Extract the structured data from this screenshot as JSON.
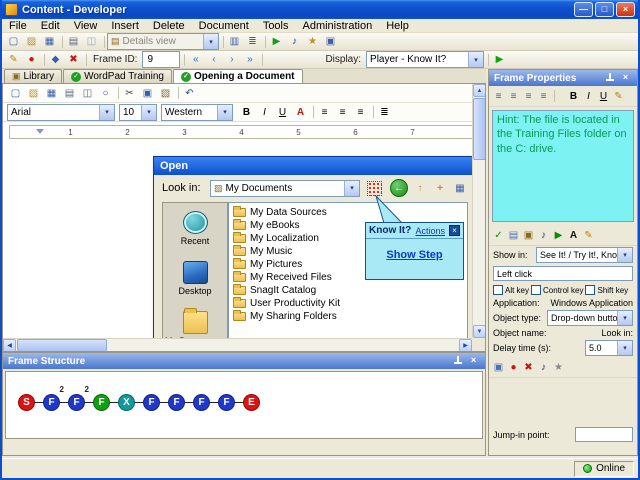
{
  "glyphs": {
    "dropdown_arrow": "▾",
    "up_arrow": "▲",
    "down_arrow": "▼",
    "left_arrow": "◀",
    "right_arrow": "▶",
    "close": "×"
  },
  "titlebar": {
    "title": "Content - Developer",
    "buttons": {
      "minimize": "—",
      "maximize": "□",
      "close": "×"
    }
  },
  "menubar": {
    "items": [
      {
        "n": "menu-file",
        "label": "File"
      },
      {
        "n": "menu-edit",
        "label": "Edit"
      },
      {
        "n": "menu-view",
        "label": "View"
      },
      {
        "n": "menu-insert",
        "label": "Insert"
      },
      {
        "n": "menu-delete",
        "label": "Delete"
      },
      {
        "n": "menu-document",
        "label": "Document"
      },
      {
        "n": "menu-tools",
        "label": "Tools"
      },
      {
        "n": "menu-administration",
        "label": "Administration"
      },
      {
        "n": "menu-help",
        "label": "Help"
      }
    ]
  },
  "toolbar1": {
    "icons_a": [
      {
        "n": "new-document-icon",
        "g": "▢",
        "st": "color:#3a5fa5",
        "ia": "true"
      },
      {
        "n": "open-icon",
        "g": "▨",
        "st": "color:#c09020",
        "ia": "true"
      },
      {
        "n": "save-icon",
        "g": "▦",
        "st": "color:#3a5fa5",
        "ia": "true"
      },
      {
        "n": "toolbar-separator",
        "g": "",
        "cls": "sep",
        "ia": "false"
      },
      {
        "n": "print-icon",
        "g": "▤",
        "st": "color:#5a6a7a",
        "ia": "true"
      },
      {
        "n": "print-preview-icon",
        "g": "◫",
        "st": "color:#9aa5b5",
        "ia": "true"
      },
      {
        "n": "toolbar-separator",
        "g": "",
        "cls": "sep",
        "ia": "false"
      }
    ],
    "details_view_value": "Details view",
    "icons_b": [
      {
        "n": "toolbar-separator",
        "g": "",
        "cls": "sep",
        "ia": "false"
      },
      {
        "n": "view-icons-icon",
        "g": "▥",
        "st": "color:#3a5fa5",
        "ia": "true"
      },
      {
        "n": "view-list-icon",
        "g": "≣",
        "st": "color:#3a5fa5",
        "ia": "true"
      },
      {
        "n": "toolbar-separator",
        "g": "",
        "cls": "sep",
        "ia": "false"
      },
      {
        "n": "preview-play-icon",
        "g": "▶",
        "st": "color:#14a014",
        "ia": "true"
      },
      {
        "n": "sound-icon",
        "g": "♪",
        "st": "color:#1a3a9a",
        "ia": "true"
      },
      {
        "n": "properties-icon",
        "g": "★",
        "st": "color:#b8912a",
        "ia": "true"
      },
      {
        "n": "screenshot-icon",
        "g": "▣",
        "st": "color:#3a5fa5",
        "ia": "true"
      }
    ]
  },
  "toolbar2": {
    "icons_a": [
      {
        "n": "edit-frame-icon",
        "g": "✎",
        "st": "color:#b8860b",
        "ia": "true"
      },
      {
        "n": "record-topic-icon",
        "g": "●",
        "st": "color:#c81414",
        "ia": "true"
      },
      {
        "n": "toolbar-separator",
        "g": "",
        "cls": "sep",
        "ia": "false"
      },
      {
        "n": "insert-frame-icon",
        "g": "◆",
        "st": "color:#3a5fa5",
        "ia": "true"
      },
      {
        "n": "delete-frame-icon",
        "g": "✖",
        "st": "color:#c81414",
        "ia": "true"
      },
      {
        "n": "toolbar-separator",
        "g": "",
        "cls": "sep",
        "ia": "false"
      }
    ],
    "frame_id_label": "Frame ID:",
    "frame_id_value": "9",
    "icons_b": [
      {
        "n": "toolbar-separator",
        "g": "",
        "cls": "sep",
        "ia": "false"
      },
      {
        "n": "first-frame-icon",
        "g": "«",
        "st": "color:#2a6ac0",
        "ia": "true"
      },
      {
        "n": "previous-frame-icon",
        "g": "‹",
        "st": "color:#2a6ac0",
        "ia": "true"
      },
      {
        "n": "next-frame-icon",
        "g": "›",
        "st": "color:#2a6ac0",
        "ia": "true"
      },
      {
        "n": "last-frame-icon",
        "g": "»",
        "st": "color:#2a6ac0",
        "ia": "true"
      },
      {
        "n": "toolbar-separator",
        "g": "",
        "cls": "sep",
        "ia": "false"
      }
    ],
    "display_label": "Display:",
    "display_value": "Player - Know It?",
    "icons_c": [
      {
        "n": "toolbar-separator",
        "g": "",
        "cls": "sep",
        "ia": "false"
      },
      {
        "n": "preview-mode-icon",
        "g": "▶",
        "st": "color:#14a014",
        "ia": "true"
      }
    ]
  },
  "tabs": {
    "items": [
      {
        "n": "tab-library",
        "label": "Library",
        "icon": "▣",
        "cls": "lib",
        "active": ""
      },
      {
        "n": "tab-wordpad-training",
        "label": "WordPad Training",
        "icon": "✓",
        "cls": "chk",
        "active": ""
      },
      {
        "n": "tab-opening-a-document",
        "label": "Opening a Document",
        "icon": "✓",
        "cls": "chk",
        "active": "active"
      }
    ]
  },
  "wordpad": {
    "toolbar_icons": [
      {
        "n": "new-icon",
        "g": "▢",
        "st": "color:#3a5fa5",
        "ia": "true"
      },
      {
        "n": "open-icon",
        "g": "▨",
        "st": "color:#c09020",
        "ia": "true"
      },
      {
        "n": "save-icon",
        "g": "▦",
        "st": "color:#3a5fa5",
        "ia": "true"
      },
      {
        "n": "print-icon",
        "g": "▤",
        "st": "color:#5a6a7a",
        "ia": "true"
      },
      {
        "n": "print-preview-icon",
        "g": "◫",
        "st": "color:#5a6a7a",
        "ia": "true"
      },
      {
        "n": "find-icon",
        "g": "○",
        "st": "color:#2a4a8a",
        "ia": "true"
      },
      {
        "n": "toolbar-separator",
        "g": "",
        "cls": "sep",
        "ia": "false"
      },
      {
        "n": "cut-icon",
        "g": "✂",
        "st": "color:#444",
        "ia": "true"
      },
      {
        "n": "copy-icon",
        "g": "▣",
        "st": "color:#3a5fa5",
        "ia": "true"
      },
      {
        "n": "paste-icon",
        "g": "▧",
        "st": "color:#8a6a2a",
        "ia": "true"
      },
      {
        "n": "toolbar-separator",
        "g": "",
        "cls": "sep",
        "ia": "false"
      },
      {
        "n": "undo-icon",
        "g": "↶",
        "st": "color:#2a4a8a",
        "ia": "true"
      }
    ],
    "font_name": "Arial",
    "font_size": "10",
    "font_script": "Western",
    "format_icons": [
      {
        "n": "bold-button",
        "g": "B",
        "st": "font-weight:bold",
        "ia": "true"
      },
      {
        "n": "italic-button",
        "g": "I",
        "st": "font-style:italic",
        "ia": "true"
      },
      {
        "n": "underline-button",
        "g": "U",
        "st": "text-decoration:underline",
        "ia": "true"
      },
      {
        "n": "font-color-button",
        "g": "A",
        "st": "color:#c81414;font-weight:bold",
        "ia": "true"
      },
      {
        "n": "toolbar-separator",
        "g": "",
        "cls": "sep",
        "ia": "false"
      },
      {
        "n": "align-left-button",
        "g": "≡",
        "st": "",
        "ia": "true"
      },
      {
        "n": "align-center-button",
        "g": "≡",
        "st": "",
        "ia": "true"
      },
      {
        "n": "align-right-button",
        "g": "≡",
        "st": "",
        "ia": "true"
      },
      {
        "n": "toolbar-separator",
        "g": "",
        "cls": "sep",
        "ia": "false"
      },
      {
        "n": "bullets-button",
        "g": "≣",
        "st": "",
        "ia": "true"
      }
    ],
    "ruler_numbers": [
      {
        "g": "1"
      },
      {
        "g": "2"
      },
      {
        "g": "3"
      },
      {
        "g": "4"
      },
      {
        "g": "5"
      },
      {
        "g": "6"
      },
      {
        "g": "7"
      }
    ]
  },
  "open_dialog": {
    "title": "Open",
    "look_in_label": "Look in:",
    "look_in_value": "My Documents",
    "toolbar_icons": [
      {
        "n": "back-icon",
        "g": "←",
        "cls": "back",
        "ia": "true"
      },
      {
        "n": "up-one-level-icon",
        "g": "↑",
        "cls": "up",
        "ia": "true"
      },
      {
        "n": "new-folder-icon",
        "g": "+",
        "cls": "newf",
        "ia": "true"
      },
      {
        "n": "views-icon",
        "g": "▦",
        "cls": "views",
        "ia": "true"
      }
    ],
    "places": [
      {
        "n": "place-recent",
        "label": "Recent",
        "cls": "ic-recent"
      },
      {
        "n": "place-desktop",
        "label": "Desktop",
        "cls": "ic-desktop"
      },
      {
        "n": "place-my-documents",
        "label": "My Documents",
        "cls": "ic-mydocs"
      }
    ],
    "files": [
      {
        "name": "My Data Sources"
      },
      {
        "name": "My eBooks"
      },
      {
        "name": "My Localization"
      },
      {
        "name": "My Music"
      },
      {
        "name": "My Pictures"
      },
      {
        "name": "My Received Files"
      },
      {
        "name": "SnagIt Catalog"
      },
      {
        "name": "User Productivity Kit"
      },
      {
        "name": "My Sharing Folders"
      }
    ]
  },
  "callout": {
    "title": "Know It?",
    "actions_link": "Actions",
    "close": "×",
    "show_step_link": "Show Step"
  },
  "frame_structure": {
    "title": "Frame Structure",
    "nodes": [
      {
        "g": "S",
        "sup": "",
        "st": "background:#df1212"
      },
      {
        "g": "F",
        "sup": "2",
        "st": "background:#2038c8"
      },
      {
        "g": "F",
        "sup": "2",
        "st": "background:#2038c8"
      },
      {
        "g": "F",
        "sup": "",
        "st": "background:#12a012"
      },
      {
        "g": "X",
        "sup": "",
        "st": "background:#0d9aa0"
      },
      {
        "g": "F",
        "sup": "",
        "st": "background:#2038c8"
      },
      {
        "g": "F",
        "sup": "",
        "st": "background:#2038c8"
      },
      {
        "g": "F",
        "sup": "",
        "st": "background:#2038c8"
      },
      {
        "g": "F",
        "sup": "",
        "st": "background:#2038c8"
      },
      {
        "g": "E",
        "sup": "",
        "st": "background:#df1212"
      }
    ]
  },
  "frame_properties": {
    "title": "Frame Properties",
    "format_icons": [
      {
        "n": "align-left-icon",
        "g": "≡",
        "st": "color:#3a5fa5",
        "ia": "true"
      },
      {
        "n": "align-center-icon",
        "g": "≡",
        "st": "color:#3a5fa5",
        "ia": "true"
      },
      {
        "n": "align-right-icon",
        "g": "≡",
        "st": "color:#3a5fa5",
        "ia": "true"
      },
      {
        "n": "align-justify-icon",
        "g": "≡",
        "st": "color:#3a5fa5",
        "ia": "true"
      },
      {
        "n": "toolbar-separator",
        "g": "",
        "cls": "sep",
        "ia": "false"
      },
      {
        "n": "bold-button",
        "g": "B",
        "st": "font-weight:bold",
        "ia": "true"
      },
      {
        "n": "italic-button",
        "g": "I",
        "st": "font-style:italic",
        "ia": "true"
      },
      {
        "n": "underline-button",
        "g": "U",
        "st": "text-decoration:underline",
        "ia": "true"
      },
      {
        "n": "font-color-button",
        "g": "✎",
        "st": "color:#b8860b",
        "ia": "true"
      }
    ],
    "hint_text": "Hint: The file is located in the Training Files folder on the C: drive.",
    "tool_icons": [
      {
        "n": "spellcheck-icon",
        "g": "✓",
        "st": "color:#0a8a0a",
        "ia": "true"
      },
      {
        "n": "template-text-icon",
        "g": "▤",
        "st": "color:#4a6fb5",
        "ia": "true"
      },
      {
        "n": "glossary-icon",
        "g": "▣",
        "st": "color:#8a6a1a",
        "ia": "true"
      },
      {
        "n": "sound-icon",
        "g": "♪",
        "st": "color:#1a3a8a",
        "ia": "true"
      },
      {
        "n": "play-sound-icon",
        "g": "▶",
        "st": "color:#0a8a0a",
        "ia": "true"
      },
      {
        "n": "font-icon",
        "g": "A",
        "st": "color:#111;font-weight:bold",
        "ia": "true"
      },
      {
        "n": "edit-text-icon",
        "g": "✎",
        "st": "color:#b8860b",
        "ia": "true"
      }
    ],
    "show_in_label": "Show in:",
    "show_in_value": "See It! / Try It!, Know It?, Do",
    "click_value": "Left click",
    "modifier_checkboxes": [
      {
        "label": "Alt key"
      },
      {
        "label": "Control key"
      },
      {
        "label": "Shift key"
      }
    ],
    "application_label": "Application:",
    "application_value": "Windows Application",
    "object_type_label": "Object type:",
    "object_type_value": "Drop-down button",
    "object_name_label": "Object name:",
    "object_name_value": "Look in:",
    "delay_label": "Delay time (s):",
    "delay_value": "5.0",
    "action_icons": [
      {
        "n": "recapture-object-icon",
        "g": "▣",
        "st": "color:#4a6fb5",
        "ia": "true"
      },
      {
        "n": "record-sound-icon",
        "g": "●",
        "st": "color:#c81414",
        "ia": "true"
      },
      {
        "n": "delete-sound-icon",
        "g": "✖",
        "st": "color:#c81414",
        "ia": "true"
      },
      {
        "n": "sound-properties-icon",
        "g": "♪",
        "st": "color:#1a3a8a",
        "ia": "true"
      },
      {
        "n": "settings-icon",
        "g": "★",
        "st": "color:#8a8a8a",
        "ia": "true"
      }
    ],
    "jump_in_label": "Jump-in point:"
  },
  "statusbar": {
    "online": "Online"
  }
}
